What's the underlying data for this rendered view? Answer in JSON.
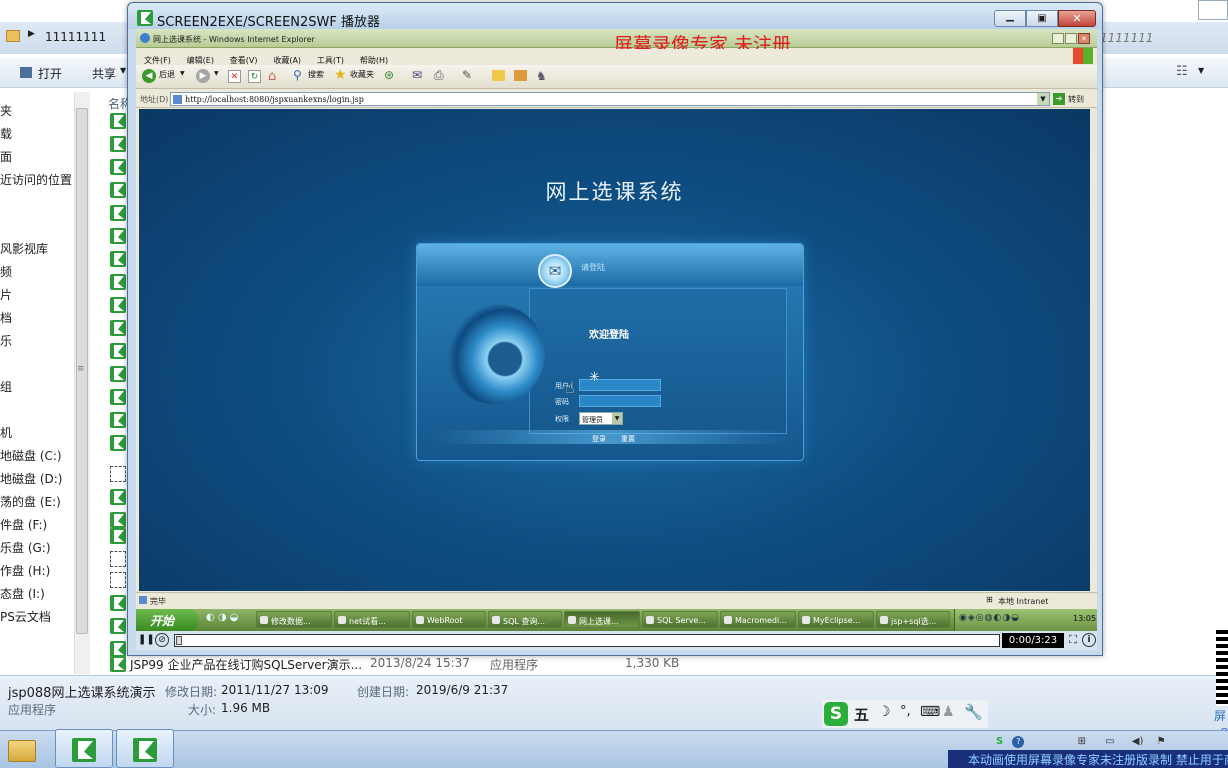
{
  "explorer": {
    "breadcrumb": "11111111",
    "breadcrumb_right": "1111111",
    "open_label": "打开",
    "share_label": "共享",
    "column_name": "名称",
    "nav_items": [
      "夹",
      "载",
      "面",
      "近访问的位置",
      "风影视库",
      "频",
      "片",
      "档",
      "乐",
      "组",
      "机",
      "地磁盘 (C:)",
      "地磁盘 (D:)",
      "荡的盘 (E:)",
      "件盘 (F:)",
      "乐盘 (G:)",
      "作盘 (H:)",
      "态盘 (I:)",
      "PS云文档"
    ],
    "bottom_row": {
      "name": "JSP99 企业产品在线订购SQLServer演示...",
      "date": "2013/8/24 15:37",
      "type": "应用程序",
      "size": "1,330 KB"
    },
    "details": {
      "name": "jsp088网上选课系统演示",
      "modified_label": "修改日期:",
      "modified": "2011/11/27 13:09",
      "created_label": "创建日期:",
      "created": "2019/6/9 21:37",
      "type": "应用程序",
      "size_label": "大小:",
      "size": "1.96 MB"
    }
  },
  "player": {
    "title": "SCREEN2EXE/SCREEN2SWF 播放器",
    "watermark": "屏幕录像专家  未注册",
    "time": "0:00/3:23",
    "progress": 0
  },
  "ie": {
    "title": "网上选课系统 - Windows Internet Explorer",
    "menu": [
      "文件(F)",
      "编辑(E)",
      "查看(V)",
      "收藏(A)",
      "工具(T)",
      "帮助(H)"
    ],
    "toolbar": {
      "back": "后退",
      "search": "搜索",
      "favorites": "收藏夹"
    },
    "address_label": "地址(D)",
    "url": "http://localhost:8080/jspxuankexns/login.jsp",
    "go_label": "转到",
    "status_left": "完毕",
    "status_right": "本地 Intranet"
  },
  "login": {
    "page_title": "网上选课系统",
    "tab_label": "请登陆",
    "welcome": "欢迎登陆",
    "user_label": "用户",
    "password_label": "密码",
    "role_label": "权限",
    "role_value": "管理员",
    "login_btn": "登录",
    "reset_btn": "重置"
  },
  "inner_taskbar": {
    "start": "开始",
    "items": [
      "修改数据...",
      "net试看...",
      "WebRoot",
      "SQL 查询...",
      "网上选课...",
      "SQL Serve...",
      "Macromedi...",
      "MyEclipse...",
      "jsp+sql选..."
    ],
    "clock": "13:05"
  },
  "ime": {
    "label": "五"
  },
  "banner": "本动画使用屏幕录像专家未注册版录制 禁止用于商业用途",
  "side_text": [
    "屏",
    "Q"
  ]
}
